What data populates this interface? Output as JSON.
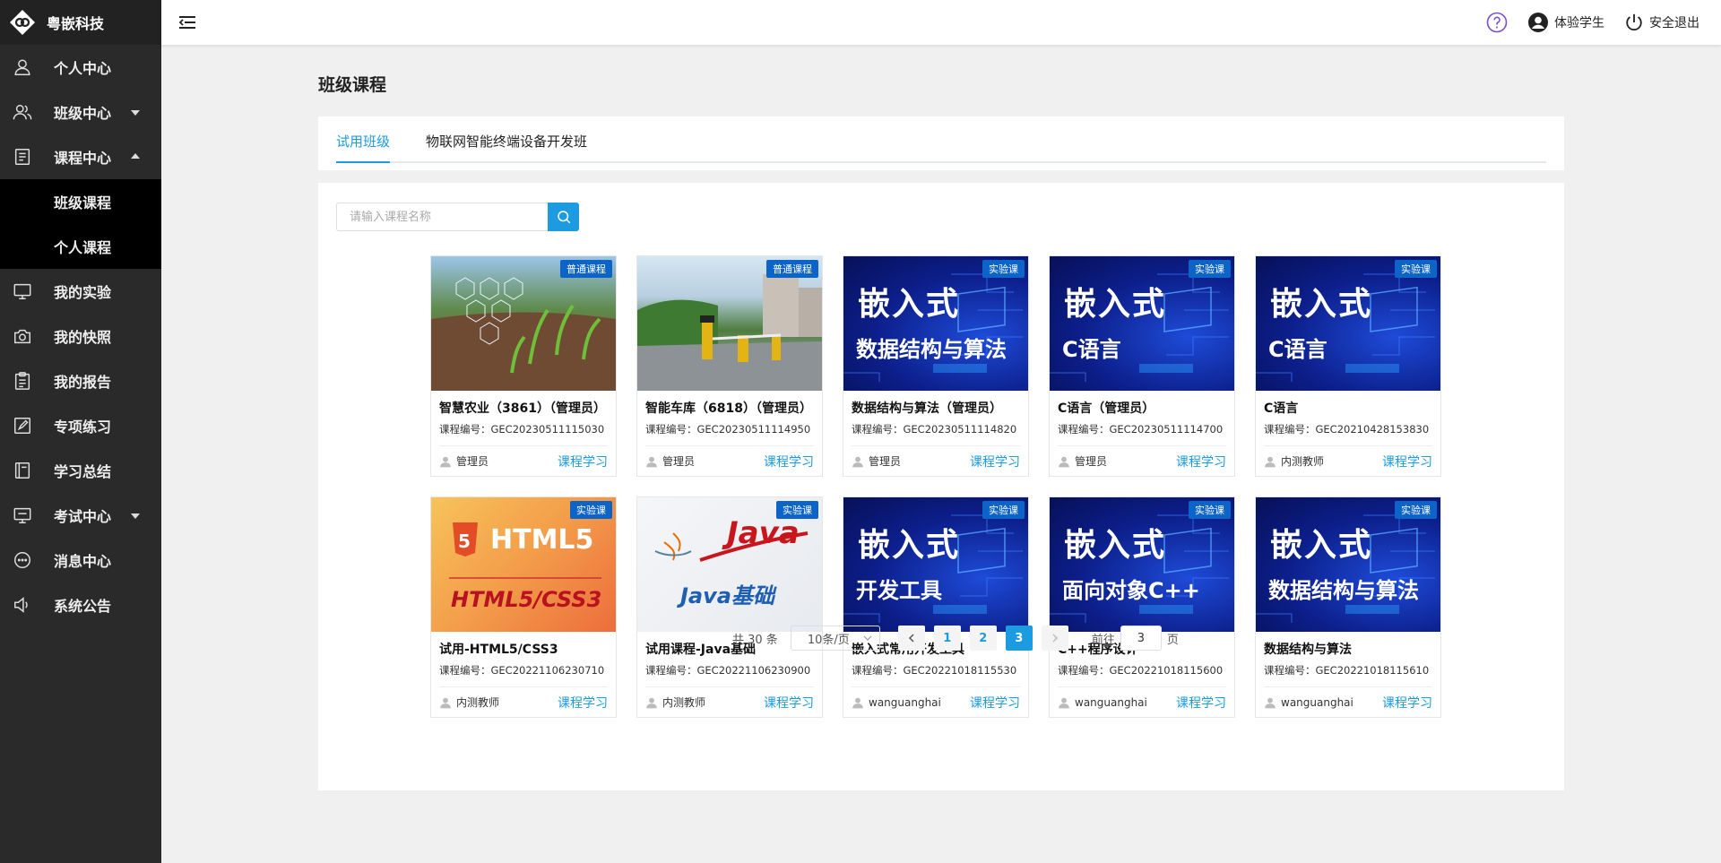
{
  "brand": {
    "name": "粤嵌科技"
  },
  "sidebar": {
    "items": [
      {
        "label": "个人中心",
        "icon": "user-icon"
      },
      {
        "label": "班级中心",
        "icon": "users-icon",
        "caret": "down"
      },
      {
        "label": "课程中心",
        "icon": "book-icon",
        "caret": "up",
        "expanded": true
      },
      {
        "label": "我的实验",
        "icon": "monitor-icon"
      },
      {
        "label": "我的快照",
        "icon": "camera-icon"
      },
      {
        "label": "我的报告",
        "icon": "clipboard-icon"
      },
      {
        "label": "专项练习",
        "icon": "edit-icon"
      },
      {
        "label": "学习总结",
        "icon": "notebook-icon"
      },
      {
        "label": "考试中心",
        "icon": "exam-icon",
        "caret": "down"
      },
      {
        "label": "消息中心",
        "icon": "message-icon"
      },
      {
        "label": "系统公告",
        "icon": "speaker-icon"
      }
    ],
    "sub_items": [
      "班级课程",
      "个人课程"
    ]
  },
  "topbar": {
    "user_label": "体验学生",
    "logout_label": "安全退出"
  },
  "page": {
    "title": "班级课程"
  },
  "tabs": [
    {
      "label": "试用班级",
      "active": true
    },
    {
      "label": "物联网智能终端设备开发班",
      "active": false
    }
  ],
  "search": {
    "placeholder": "请输入课程名称",
    "value": ""
  },
  "courses": [
    {
      "tag": "普通课程",
      "title": "智慧农业（3861）（管理员）",
      "code": "课程编号：GEC20230511115030",
      "author": "管理员",
      "action": "课程学习",
      "thumb": "farm"
    },
    {
      "tag": "普通课程",
      "title": "智能车库（6818）（管理员）",
      "code": "课程编号：GEC20230511114950",
      "author": "管理员",
      "action": "课程学习",
      "thumb": "parking"
    },
    {
      "tag": "实验课",
      "title": "数据结构与算法（管理员）",
      "code": "课程编号：GEC20230511114820",
      "author": "管理员",
      "action": "课程学习",
      "thumb": "blue",
      "thumb_line1": "嵌入式",
      "thumb_line2": "数据结构与算法"
    },
    {
      "tag": "实验课",
      "title": "C语言（管理员）",
      "code": "课程编号：GEC20230511114700",
      "author": "管理员",
      "action": "课程学习",
      "thumb": "blue",
      "thumb_line1": "嵌入式",
      "thumb_line2": "C语言"
    },
    {
      "tag": "实验课",
      "title": "C语言",
      "code": "课程编号：GEC20210428153830",
      "author": "内测教师",
      "action": "课程学习",
      "thumb": "blue",
      "thumb_line1": "嵌入式",
      "thumb_line2": "C语言"
    },
    {
      "tag": "实验课",
      "title": "试用-HTML5/CSS3",
      "code": "课程编号：GEC20221106230710",
      "author": "内测教师",
      "action": "课程学习",
      "thumb": "html",
      "thumb_line1": "HTML5",
      "thumb_line2": "HTML5/CSS3"
    },
    {
      "tag": "实验课",
      "title": "试用课程-Java基础",
      "code": "课程编号：GEC20221106230900",
      "author": "内测教师",
      "action": "课程学习",
      "thumb": "java",
      "thumb_line1": "Java",
      "thumb_line2": "Java基础"
    },
    {
      "tag": "实验课",
      "title": "嵌入式常用开发工具",
      "code": "课程编号：GEC20221018115530",
      "author": "wanguanghai",
      "action": "课程学习",
      "thumb": "blue",
      "thumb_line1": "嵌入式",
      "thumb_line2": "开发工具"
    },
    {
      "tag": "实验课",
      "title": "C++程序设计",
      "code": "课程编号：GEC20221018115600",
      "author": "wanguanghai",
      "action": "课程学习",
      "thumb": "blue",
      "thumb_line1": "嵌入式",
      "thumb_line2": "面向对象C++"
    },
    {
      "tag": "实验课",
      "title": "数据结构与算法",
      "code": "课程编号：GEC20221018115610",
      "author": "wanguanghai",
      "action": "课程学习",
      "thumb": "blue",
      "thumb_line1": "嵌入式",
      "thumb_line2": "数据结构与算法"
    }
  ],
  "pagination": {
    "total_label": "共 30 条",
    "page_size_label": "10条/页",
    "pages": [
      "1",
      "2",
      "3"
    ],
    "current": "3",
    "goto_prefix": "前往",
    "goto_value": "3",
    "goto_suffix": "页"
  },
  "colors": {
    "accent": "#1d9be0",
    "sidebar": "#2a2a2a",
    "tag": "#0d64c8"
  }
}
